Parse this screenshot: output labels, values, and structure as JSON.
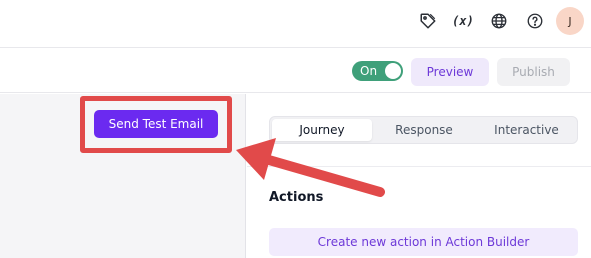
{
  "header": {
    "icons": [
      "tag-icon",
      "variables-icon",
      "globe-icon",
      "help-icon"
    ],
    "variables_glyph": "(x)",
    "avatar_initial": "J"
  },
  "toolbar": {
    "toggle_label": "On",
    "toggle_on": true,
    "preview_label": "Preview",
    "publish_label": "Publish"
  },
  "canvas": {
    "send_test_email_label": "Send Test Email"
  },
  "panel": {
    "tabs": [
      {
        "label": "Journey",
        "active": true
      },
      {
        "label": "Response",
        "active": false
      },
      {
        "label": "Interactive",
        "active": false
      }
    ],
    "actions_title": "Actions",
    "create_action_label": "Create new action in Action Builder"
  },
  "colors": {
    "accent_purple": "#6b2af0",
    "toggle_green": "#3fa07a",
    "annotation_red": "#e14a4a"
  }
}
